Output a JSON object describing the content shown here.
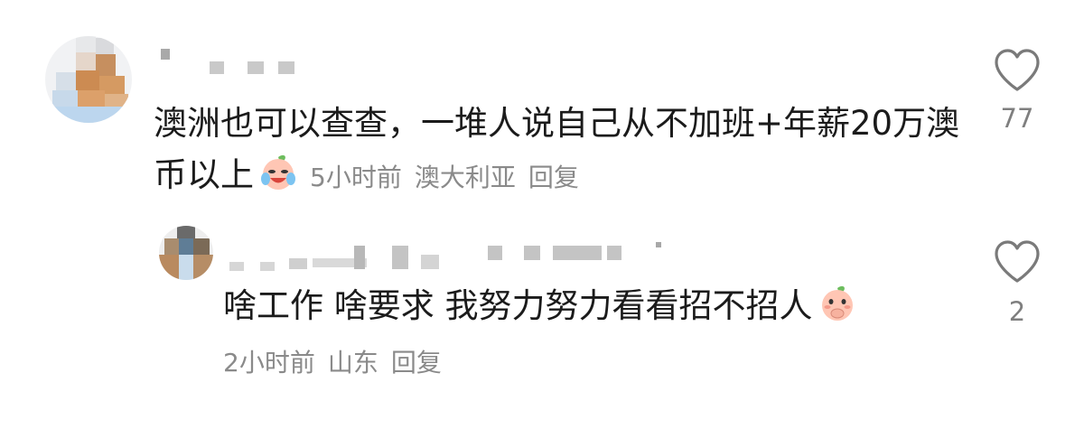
{
  "comments": [
    {
      "text": "澳洲也可以查查，一堆人说自己从不加班+年薪20万澳币以上",
      "emoji": "crying-laughing-peach-emoji",
      "time": "5小时前",
      "location": "澳大利亚",
      "reply_label": "回复",
      "like_icon": "heart-outline-icon",
      "like_count": "77"
    },
    {
      "text": "啥工作 啥要求 我努力努力看看招不招人",
      "emoji": "peach-hand-on-mouth-emoji",
      "time": "2小时前",
      "location": "山东",
      "reply_label": "回复",
      "like_icon": "heart-outline-icon",
      "like_count": "2"
    }
  ],
  "colors": {
    "text": "#1b1b1b",
    "meta": "#8a8a8a",
    "icon": "#7a7a7a"
  }
}
